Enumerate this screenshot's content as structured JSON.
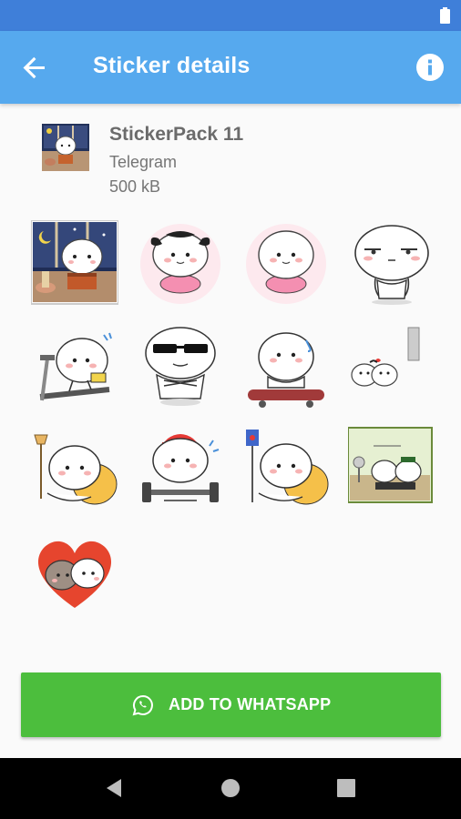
{
  "app_bar": {
    "title": "Sticker details",
    "back_icon": "arrow-back-icon",
    "info_icon": "info-icon"
  },
  "pack": {
    "name": "StickerPack 11",
    "publisher": "Telegram",
    "size": "500 kB"
  },
  "stickers": [
    "night-room-character",
    "girl-bow-float-ring",
    "float-ring-character",
    "smug-face-character",
    "treadmill-character",
    "sunglasses-character",
    "skateboard-character",
    "couple-hiding-character",
    "lamp-beanbag-character",
    "dumbbell-character",
    "juice-beanbag-character",
    "picnic-couple-scene",
    "heart-couple-characters"
  ],
  "action": {
    "add_label": "ADD TO WHATSAPP",
    "icon": "whatsapp-icon"
  },
  "colors": {
    "status_bar": "#3f7fd9",
    "app_bar": "#56a9ee",
    "button": "#4cbe3d",
    "nav_bar": "#000000"
  }
}
